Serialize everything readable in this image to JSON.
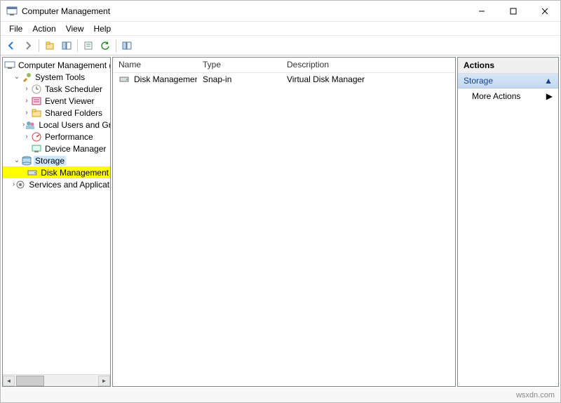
{
  "title": "Computer Management",
  "menu": [
    "File",
    "Action",
    "View",
    "Help"
  ],
  "tree": {
    "root": "Computer Management (Local",
    "system_tools": "System Tools",
    "task_scheduler": "Task Scheduler",
    "event_viewer": "Event Viewer",
    "shared_folders": "Shared Folders",
    "local_users": "Local Users and Groups",
    "performance": "Performance",
    "device_manager": "Device Manager",
    "storage": "Storage",
    "disk_management": "Disk Management",
    "services_apps": "Services and Applications"
  },
  "list": {
    "cols": {
      "name": "Name",
      "type": "Type",
      "desc": "Description"
    },
    "rows": [
      {
        "name": "Disk Management(Lo...",
        "type": "Snap-in",
        "desc": "Virtual Disk Manager"
      }
    ]
  },
  "actions": {
    "title": "Actions",
    "section": "Storage",
    "more": "More Actions"
  },
  "footer": "wsxdn.com"
}
